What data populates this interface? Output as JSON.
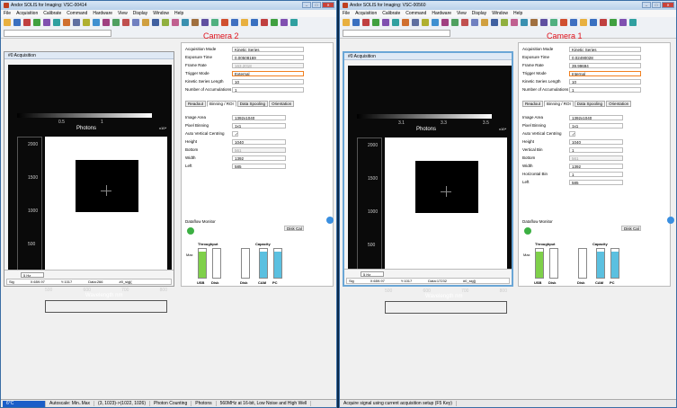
{
  "windows": [
    {
      "title": "Andor SOLIS for Imaging: VSC-00414",
      "label": "Camera 2",
      "menu": [
        "File",
        "Acquisition",
        "Calibrate",
        "Command",
        "Hardware",
        "View",
        "Display",
        "Window",
        "Help"
      ],
      "doc_title": "#0 Acquisition",
      "colorbar": {
        "ticks": [
          "0.5",
          "1"
        ],
        "title": "Photons",
        "exp": "x10⁴"
      },
      "yticks": [
        "2000",
        "1500",
        "1000",
        "500"
      ],
      "xticks": [
        "500",
        "600",
        "700",
        "800"
      ],
      "xlabel": "Wavelength nm",
      "speed": "5 Hz",
      "status": {
        "sig": "Sig",
        "coords": "X:659.97",
        "y": "Y:1017",
        "data": "Data:266",
        "tag": "#0_sig[("
      },
      "params": [
        {
          "k": "Acquisition Mode",
          "v": "Kinetic Series"
        },
        {
          "k": "Exposure Time",
          "v": "0.00508169"
        },
        {
          "k": "Frame Rate",
          "v": "163.2018",
          "dis": true
        },
        {
          "k": "Trigger Mode",
          "v": "External",
          "hl": true
        },
        {
          "k": "Kinetic Series Length",
          "v": "10"
        },
        {
          "k": "Number of Accumulations",
          "v": "1"
        }
      ],
      "tabs": [
        "Readout",
        "Binning / ROI",
        "Data Spooling",
        "Orientation"
      ],
      "roi": [
        {
          "k": "Image Area",
          "v": "1392x1040"
        },
        {
          "k": "Pixel Binning",
          "v": "1x1"
        },
        {
          "k": "Auto Vertical Centring",
          "v": "✓"
        },
        {
          "k": "Height",
          "v": "1040"
        },
        {
          "k": "Bottom",
          "v": "561",
          "dis": true
        },
        {
          "k": "Width",
          "v": "1392"
        },
        {
          "k": "Left",
          "v": "585"
        }
      ],
      "dataflow": {
        "title": "Dataflow Monitor",
        "btn": "Disk Cal",
        "thr": "Throughput",
        "cap": "Capacity",
        "max": "Max",
        "g": [
          "USB",
          "Disk",
          "Disk",
          "CAM",
          "PC"
        ]
      },
      "statusbar": [
        "6°C",
        "Autoscale: Min..Max",
        "(3, 1023)->(1022, 1026)",
        "Photon Counting",
        "Photons",
        "560MHz at 16-bit, Low Noise and High Well"
      ]
    },
    {
      "title": "Andor SOLIS for Imaging: VSC-00560",
      "label": "Camera 1",
      "menu": [
        "File",
        "Acquisition",
        "Calibrate",
        "Command",
        "Hardware",
        "View",
        "Display",
        "Window",
        "Help"
      ],
      "doc_title": "#0 Acquisition",
      "colorbar": {
        "ticks": [
          "3.1",
          "3.3",
          "3.5",
          "3.7"
        ],
        "title": "Photons",
        "exp": "x10⁴"
      },
      "yticks": [
        "2000",
        "1500",
        "1000",
        "500"
      ],
      "xticks": [
        "500",
        "600",
        "700",
        "800"
      ],
      "xlabel": "Wavelength nm",
      "speed": "5 Hz",
      "status": {
        "sig": "Sig",
        "coords": "X:659.97",
        "y": "Y:1017",
        "data": "Data:17232",
        "tag": "#0_sig[("
      },
      "params": [
        {
          "k": "Acquisition Mode",
          "v": "Kinetic Series"
        },
        {
          "k": "Exposure Time",
          "v": "0.02490028"
        },
        {
          "k": "Frame Rate",
          "v": "39.99694"
        },
        {
          "k": "Trigger Mode",
          "v": "Internal",
          "hl": true
        },
        {
          "k": "Kinetic Series Length",
          "v": "10"
        },
        {
          "k": "Number of Accumulations",
          "v": "1"
        }
      ],
      "tabs": [
        "Readout",
        "Binning / ROI",
        "Data Spooling",
        "Orientation"
      ],
      "roi": [
        {
          "k": "Image Area",
          "v": "1392x1040"
        },
        {
          "k": "Pixel Binning",
          "v": "1x1"
        },
        {
          "k": "Auto Vertical Centring",
          "v": "✓"
        },
        {
          "k": "Height",
          "v": "1040"
        },
        {
          "k": "Vertical Bin",
          "v": "1"
        },
        {
          "k": "Bottom",
          "v": "561",
          "dis": true
        },
        {
          "k": "Width",
          "v": "1392"
        },
        {
          "k": "Horizontal Bin",
          "v": "1"
        },
        {
          "k": "Left",
          "v": "585"
        }
      ],
      "dataflow": {
        "title": "Dataflow Monitor",
        "btn": "Disk Cal",
        "thr": "Throughput",
        "cap": "Capacity",
        "max": "Max",
        "g": [
          "USB",
          "Disk",
          "Disk",
          "CAM",
          "PC"
        ]
      },
      "statusbar": [
        "Acquire signal using current acquisition setup (F5 Key)"
      ]
    }
  ]
}
